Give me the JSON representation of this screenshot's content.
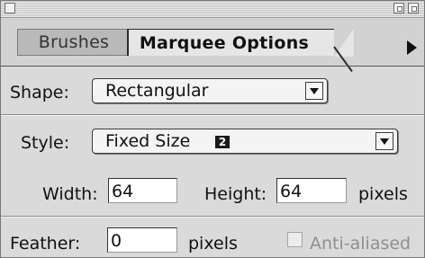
{
  "tabs": [
    {
      "label": "Brushes",
      "active": false
    },
    {
      "label": "Marquee Options",
      "active": true
    }
  ],
  "shape": {
    "label": "Shape:",
    "value": "Rectangular"
  },
  "style": {
    "label": "Style:",
    "value": "Fixed Size",
    "badge": "2"
  },
  "size": {
    "width_label": "Width:",
    "width_value": "64",
    "height_label": "Height:",
    "height_value": "64",
    "unit": "pixels"
  },
  "feather": {
    "label": "Feather:",
    "value": "0",
    "unit": "pixels",
    "anti_aliased_label": "Anti-aliased",
    "anti_aliased_checked": false,
    "anti_aliased_enabled": false
  },
  "icons": {
    "close_box": "close-box-icon",
    "zoom_box": "zoom-box-icon",
    "collapse_box": "collapse-box-icon",
    "menu_arrow": "panel-menu-arrow-icon",
    "popup_arrow": "popup-arrow-icon"
  }
}
